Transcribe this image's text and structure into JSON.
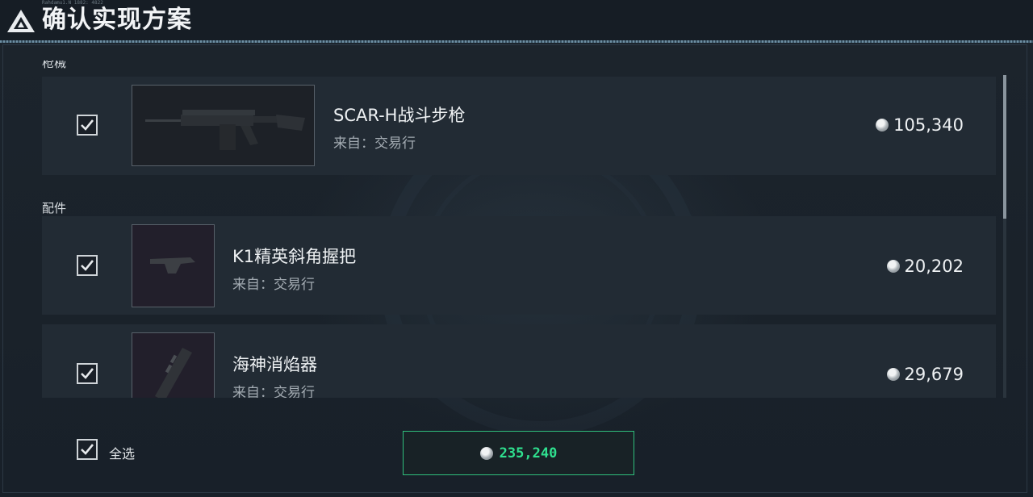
{
  "header": {
    "title": "确认实现方案",
    "tiny_text": "Rahdamu1.N 1882: 4822"
  },
  "sections": [
    {
      "label": "枪械"
    },
    {
      "label": "配件"
    }
  ],
  "items": [
    {
      "name": "SCAR-H战斗步枪",
      "source": "来自：交易行",
      "price": "105,340",
      "checked": true
    },
    {
      "name": "K1精英斜角握把",
      "source": "来自：交易行",
      "price": "20,202",
      "checked": true
    },
    {
      "name": "海神消焰器",
      "source": "来自：交易行",
      "price": "29,679",
      "checked": true
    }
  ],
  "footer": {
    "select_all_label": "全选",
    "select_all_checked": true,
    "total": "235,240"
  },
  "colors": {
    "accent_green": "#2fe08f",
    "row_bg": "#222b34",
    "page_bg": "#1a222b"
  }
}
